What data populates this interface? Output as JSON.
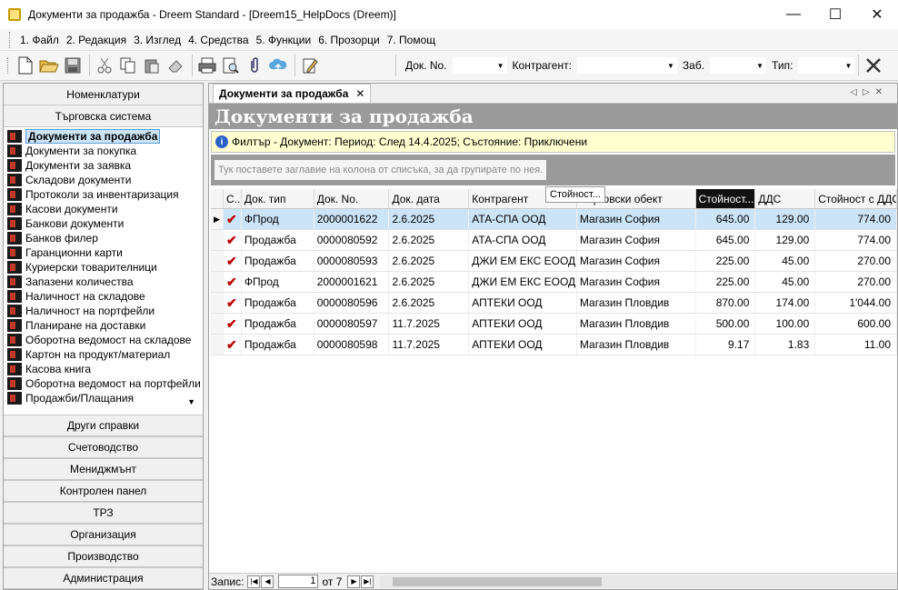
{
  "window": {
    "title": "Документи за продажба - Dreem Standard - [Dreem15_HelpDocs (Dreem)]",
    "minimize": "—",
    "maximize": "☐",
    "close": "✕"
  },
  "menu": [
    "1. Файл",
    "2. Редакция",
    "3. Изглед",
    "4. Средства",
    "5. Функции",
    "6. Прозорци",
    "7. Помощ"
  ],
  "toolbar": {
    "icons": [
      "new-document-icon",
      "open-folder-icon",
      "save-icon",
      "cut-icon",
      "copy-icon",
      "paste-icon",
      "eraser-icon",
      "print-icon",
      "print-preview-icon",
      "attach-icon",
      "upload-cloud-icon",
      "edit-note-icon"
    ],
    "filters": {
      "doc_no_label": "Док. No.",
      "contragent_label": "Контрагент:",
      "zab_label": "Заб.",
      "type_label": "Тип:"
    },
    "clear_icon": "close-x-icon"
  },
  "sidebar": {
    "top_sections": [
      "Номенклатури",
      "Търговска система"
    ],
    "items": [
      "Документи за продажба",
      "Документи за покупка",
      "Документи за заявка",
      "Складови документи",
      "Протоколи за инвентаризация",
      "Касови документи",
      "Банкови документи",
      "Банков филер",
      "Гаранционни карти",
      "Куриерски товарителници",
      "Запазени количества",
      "Наличност на складове",
      "Наличност на портфейли",
      "Планиране на доставки",
      "Оборотна ведомост на складове",
      "Картон на продукт/материал",
      "Касова книга",
      "Оборотна ведомост на портфейли",
      "Продажби/Плащания"
    ],
    "active_index": 0,
    "bottom_sections": [
      "Други справки",
      "Счетоводство",
      "Мениджмънт",
      "Контролен панел",
      "ТРЗ",
      "Организация",
      "Производство",
      "Администрация"
    ]
  },
  "main": {
    "tab": "Документи за продажба",
    "title": "Документи за продажба",
    "filter": "Филтър - Документ: Период: След 14.4.2025; Състояние: Приключени",
    "group_hint": "Тук поставете заглавие на колона от списъка, за да групирате по нея.",
    "drag_tip": "Стойност...",
    "columns": [
      "С...",
      "Док. тип",
      "Док. No.",
      "Док. дата",
      "Контрагент",
      "Търговски обект",
      "Стойност...",
      "ДДС",
      "Стойност с ДДС"
    ],
    "rows": [
      [
        "ФПрод",
        "2000001622",
        "2.6.2025",
        "АТА-СПА ООД",
        "Магазин София",
        "645.00",
        "129.00",
        "774.00"
      ],
      [
        "Продажба",
        "0000080592",
        "2.6.2025",
        "АТА-СПА ООД",
        "Магазин София",
        "645.00",
        "129.00",
        "774.00"
      ],
      [
        "Продажба",
        "0000080593",
        "2.6.2025",
        "ДЖИ ЕМ ЕКС ЕООД",
        "Магазин София",
        "225.00",
        "45.00",
        "270.00"
      ],
      [
        "ФПрод",
        "2000001621",
        "2.6.2025",
        "ДЖИ ЕМ ЕКС ЕООД",
        "Магазин София",
        "225.00",
        "45.00",
        "270.00"
      ],
      [
        "Продажба",
        "0000080596",
        "2.6.2025",
        "АПТЕКИ ООД",
        "Магазин Пловдив",
        "870.00",
        "174.00",
        "1'044.00"
      ],
      [
        "Продажба",
        "0000080597",
        "11.7.2025",
        "АПТЕКИ ООД",
        "Магазин Пловдив",
        "500.00",
        "100.00",
        "600.00"
      ],
      [
        "Продажба",
        "0000080598",
        "11.7.2025",
        "АПТЕКИ ООД",
        "Магазин Пловдив",
        "9.17",
        "1.83",
        "11.00"
      ]
    ]
  },
  "status": {
    "records_label": "Запис:",
    "page": "1",
    "of": "от 7"
  }
}
